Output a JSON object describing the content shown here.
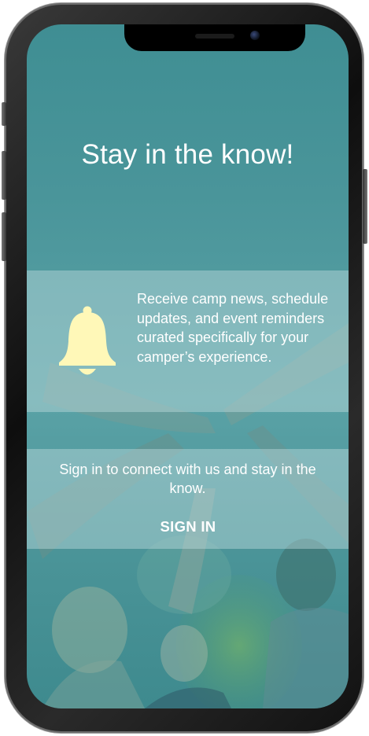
{
  "screen": {
    "title": "Stay in the know!",
    "info": {
      "icon": "bell-icon",
      "icon_color": "#fff8b8",
      "text": "Receive camp news, schedule updates, and event reminders curated specifically for your camper’s experience."
    },
    "signin": {
      "prompt": "Sign in to connect with us and stay in the know.",
      "button_label": "SIGN IN"
    }
  },
  "colors": {
    "overlay_teal": "#4a959a",
    "band": "#bedcde",
    "text": "#ffffff"
  }
}
